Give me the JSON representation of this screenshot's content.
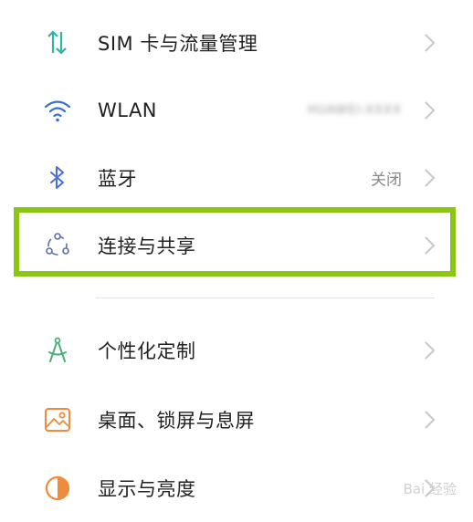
{
  "settings": {
    "items": [
      {
        "label": "SIM 卡与流量管理",
        "value": "",
        "icon": "sim-data-icon"
      },
      {
        "label": "WLAN",
        "value": "HUAWEI-XXXX",
        "icon": "wifi-icon"
      },
      {
        "label": "蓝牙",
        "value": "关闭",
        "icon": "bluetooth-icon"
      },
      {
        "label": "连接与共享",
        "value": "",
        "icon": "connection-share-icon"
      },
      {
        "label": "个性化定制",
        "value": "",
        "icon": "personalization-icon"
      },
      {
        "label": "桌面、锁屏与息屏",
        "value": "",
        "icon": "wallpaper-icon"
      },
      {
        "label": "显示与亮度",
        "value": "",
        "icon": "display-brightness-icon"
      }
    ]
  },
  "colors": {
    "highlight": "#8cc614",
    "teal": "#2fb4a6",
    "blue": "#4a6fd4",
    "orange": "#f08a3c",
    "green": "#4cae7a"
  },
  "watermark": {
    "text": "Bai 经验"
  }
}
